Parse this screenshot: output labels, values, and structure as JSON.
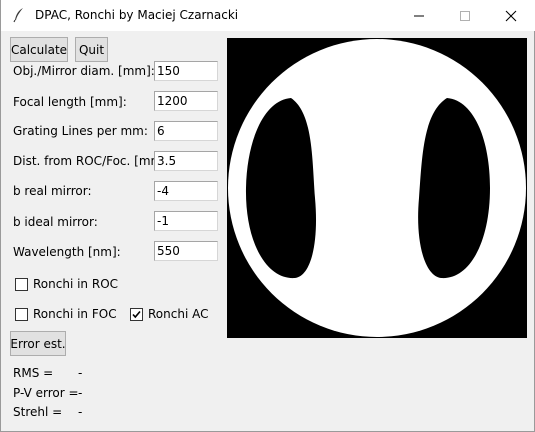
{
  "window": {
    "title": "DPAC, Ronchi by Maciej Czarnacki",
    "icon": "feather-icon"
  },
  "toolbar": {
    "calculate_label": "Calculate",
    "quit_label": "Quit"
  },
  "params": [
    {
      "label": "Obj./Mirror diam. [mm]:",
      "value": "150"
    },
    {
      "label": "Focal length [mm]:",
      "value": "1200"
    },
    {
      "label": "Grating Lines per mm:",
      "value": "6"
    },
    {
      "label": "Dist. from ROC/Foc. [mm]:",
      "value": "3.5"
    },
    {
      "label": "b real mirror:",
      "value": "-4"
    },
    {
      "label": "b ideal mirror:",
      "value": "-1"
    },
    {
      "label": "Wavelength [nm]:",
      "value": "550"
    }
  ],
  "options": {
    "ronchi_roc": {
      "label": "Ronchi in ROC",
      "checked": false
    },
    "ronchi_foc": {
      "label": "Ronchi in FOC",
      "checked": false
    },
    "ronchi_ac": {
      "label": "Ronchi AC",
      "checked": true
    }
  },
  "error_button_label": "Error est.",
  "results": {
    "rms": {
      "label": "RMS =",
      "value": "-"
    },
    "pv": {
      "label": "P-V error =",
      "value": "-"
    },
    "strehl": {
      "label": "Strehl =",
      "value": "-"
    }
  },
  "colors": {
    "pattern_background": "#000000",
    "pattern_foreground": "#ffffff"
  }
}
